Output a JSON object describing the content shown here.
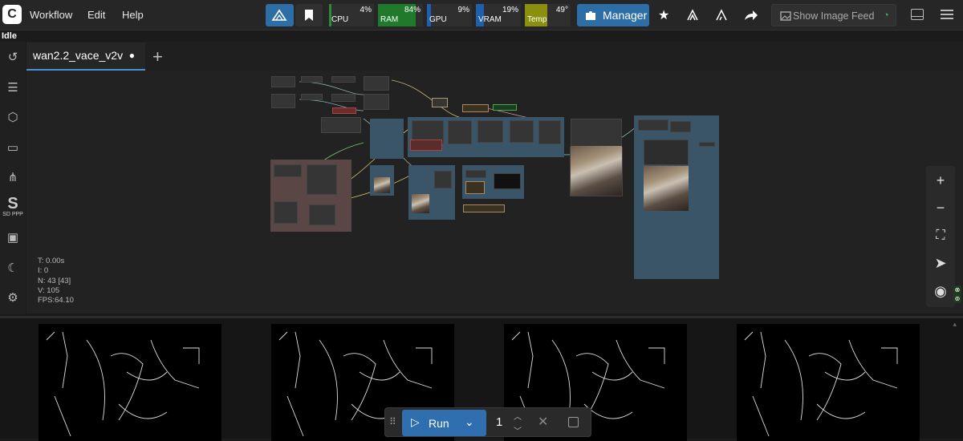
{
  "topbar": {
    "menu": [
      "Workflow",
      "Edit",
      "Help"
    ],
    "meters": [
      {
        "label": "CPU",
        "value": "4%",
        "color": "#2e8b3c"
      },
      {
        "label": "RAM",
        "value": "84%",
        "color": "#1f7a2b"
      },
      {
        "label": "GPU",
        "value": "9%",
        "color": "#1e5fae"
      },
      {
        "label": "VRAM",
        "value": "19%",
        "color": "#1e5fae"
      },
      {
        "label": "Temp",
        "value": "49°",
        "color": "#8a8f0e"
      }
    ],
    "manager_label": "Manager",
    "image_feed_label": "Show Image Feed"
  },
  "status": "Idle",
  "tabs": [
    {
      "label": "wan2.2_vace_v2v",
      "modified_marker": "●"
    }
  ],
  "stats": {
    "t": "T: 0.00s",
    "i": "I: 0",
    "n": "N: 43 [43]",
    "v": "V: 105",
    "fps": "FPS:64.10"
  },
  "sidebar_text": "SD PPP",
  "runbar": {
    "run_label": "Run",
    "batch_count": "1"
  },
  "colors": {
    "accent": "#2e6ea6",
    "tab_underline": "#4a90d9",
    "group_blue": "#3a5468",
    "group_brown": "#5a4645"
  }
}
